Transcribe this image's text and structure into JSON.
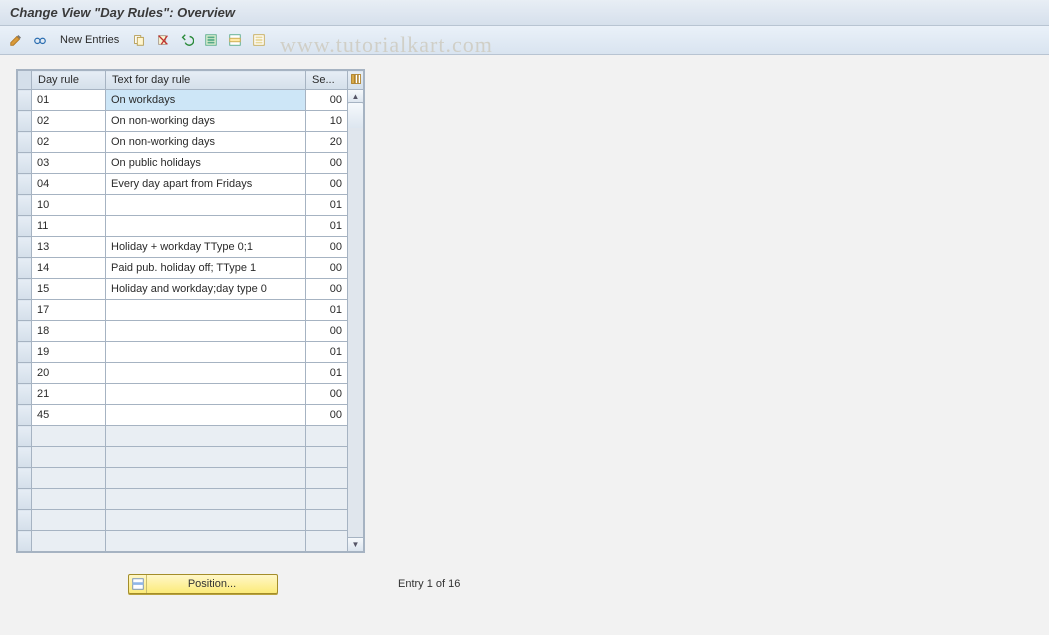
{
  "title": "Change View \"Day Rules\": Overview",
  "watermark": "www.tutorialkart.com",
  "toolbar": {
    "new_entries": "New Entries"
  },
  "table": {
    "headers": {
      "day_rule": "Day rule",
      "text": "Text for day rule",
      "seq": "Se..."
    },
    "rows": [
      {
        "dr": "01",
        "txt": "On workdays",
        "sq": "00",
        "sel": true
      },
      {
        "dr": "02",
        "txt": "On non-working days",
        "sq": "10"
      },
      {
        "dr": "02",
        "txt": "On non-working days",
        "sq": "20"
      },
      {
        "dr": "03",
        "txt": "On public holidays",
        "sq": "00"
      },
      {
        "dr": "04",
        "txt": "Every day apart from Fridays",
        "sq": "00"
      },
      {
        "dr": "10",
        "txt": "",
        "sq": "01"
      },
      {
        "dr": "11",
        "txt": "",
        "sq": "01"
      },
      {
        "dr": "13",
        "txt": "Holiday + workday TType 0;1",
        "sq": "00"
      },
      {
        "dr": "14",
        "txt": "Paid pub. holiday off; TType 1",
        "sq": "00"
      },
      {
        "dr": "15",
        "txt": "Holiday and workday;day type 0",
        "sq": "00"
      },
      {
        "dr": "17",
        "txt": "",
        "sq": "01"
      },
      {
        "dr": "18",
        "txt": "",
        "sq": "00"
      },
      {
        "dr": "19",
        "txt": "",
        "sq": "01"
      },
      {
        "dr": "20",
        "txt": "",
        "sq": "01"
      },
      {
        "dr": "21",
        "txt": "",
        "sq": "00"
      },
      {
        "dr": "45",
        "txt": "",
        "sq": "00"
      }
    ],
    "empty_rows": 6
  },
  "footer": {
    "position": "Position...",
    "entry_status": "Entry 1 of 16"
  }
}
